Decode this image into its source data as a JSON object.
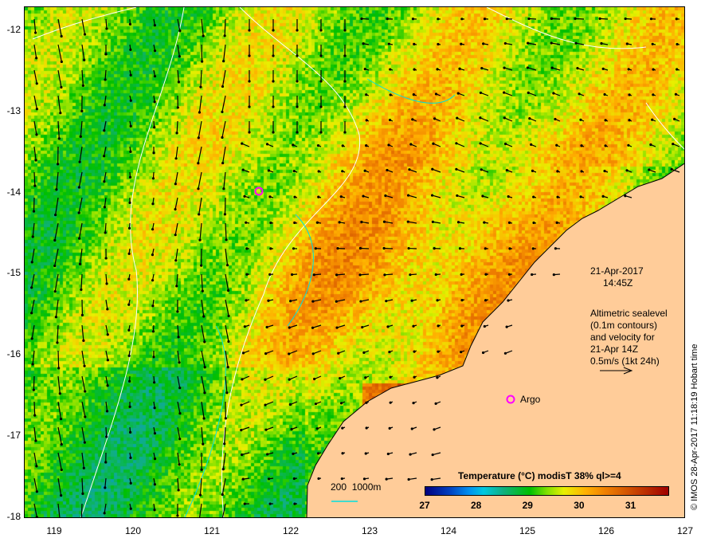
{
  "map": {
    "date": "21-Apr-2017",
    "time": "14:45Z",
    "legend_lines": [
      "Altimetric sealevel",
      "(0.1m contours)",
      "and velocity for",
      "21-Apr 14Z",
      "0.5m/s (1kt 24h)"
    ],
    "argo_label": "Argo",
    "depth_scale": "200  1000m",
    "credit": "© IMOS 28-Apr-2017 11:18:19 Hobart time",
    "lat_labels": [
      "-12",
      "-13",
      "-14",
      "-15",
      "-16",
      "-17",
      "-18"
    ],
    "lon_labels": [
      "119",
      "120",
      "121",
      "122",
      "123",
      "124",
      "125",
      "126",
      "127"
    ]
  },
  "colorbar": {
    "title": "Temperature (°C) modisT 38% ql>=4",
    "ticks": [
      "27",
      "28",
      "29",
      "30",
      "31"
    ],
    "range": [
      27,
      31.75
    ]
  },
  "colors": {
    "land": "#ffcc99",
    "argo": "#ff00ff",
    "contour": "#ffffff",
    "isobath": "#00e0e0"
  }
}
